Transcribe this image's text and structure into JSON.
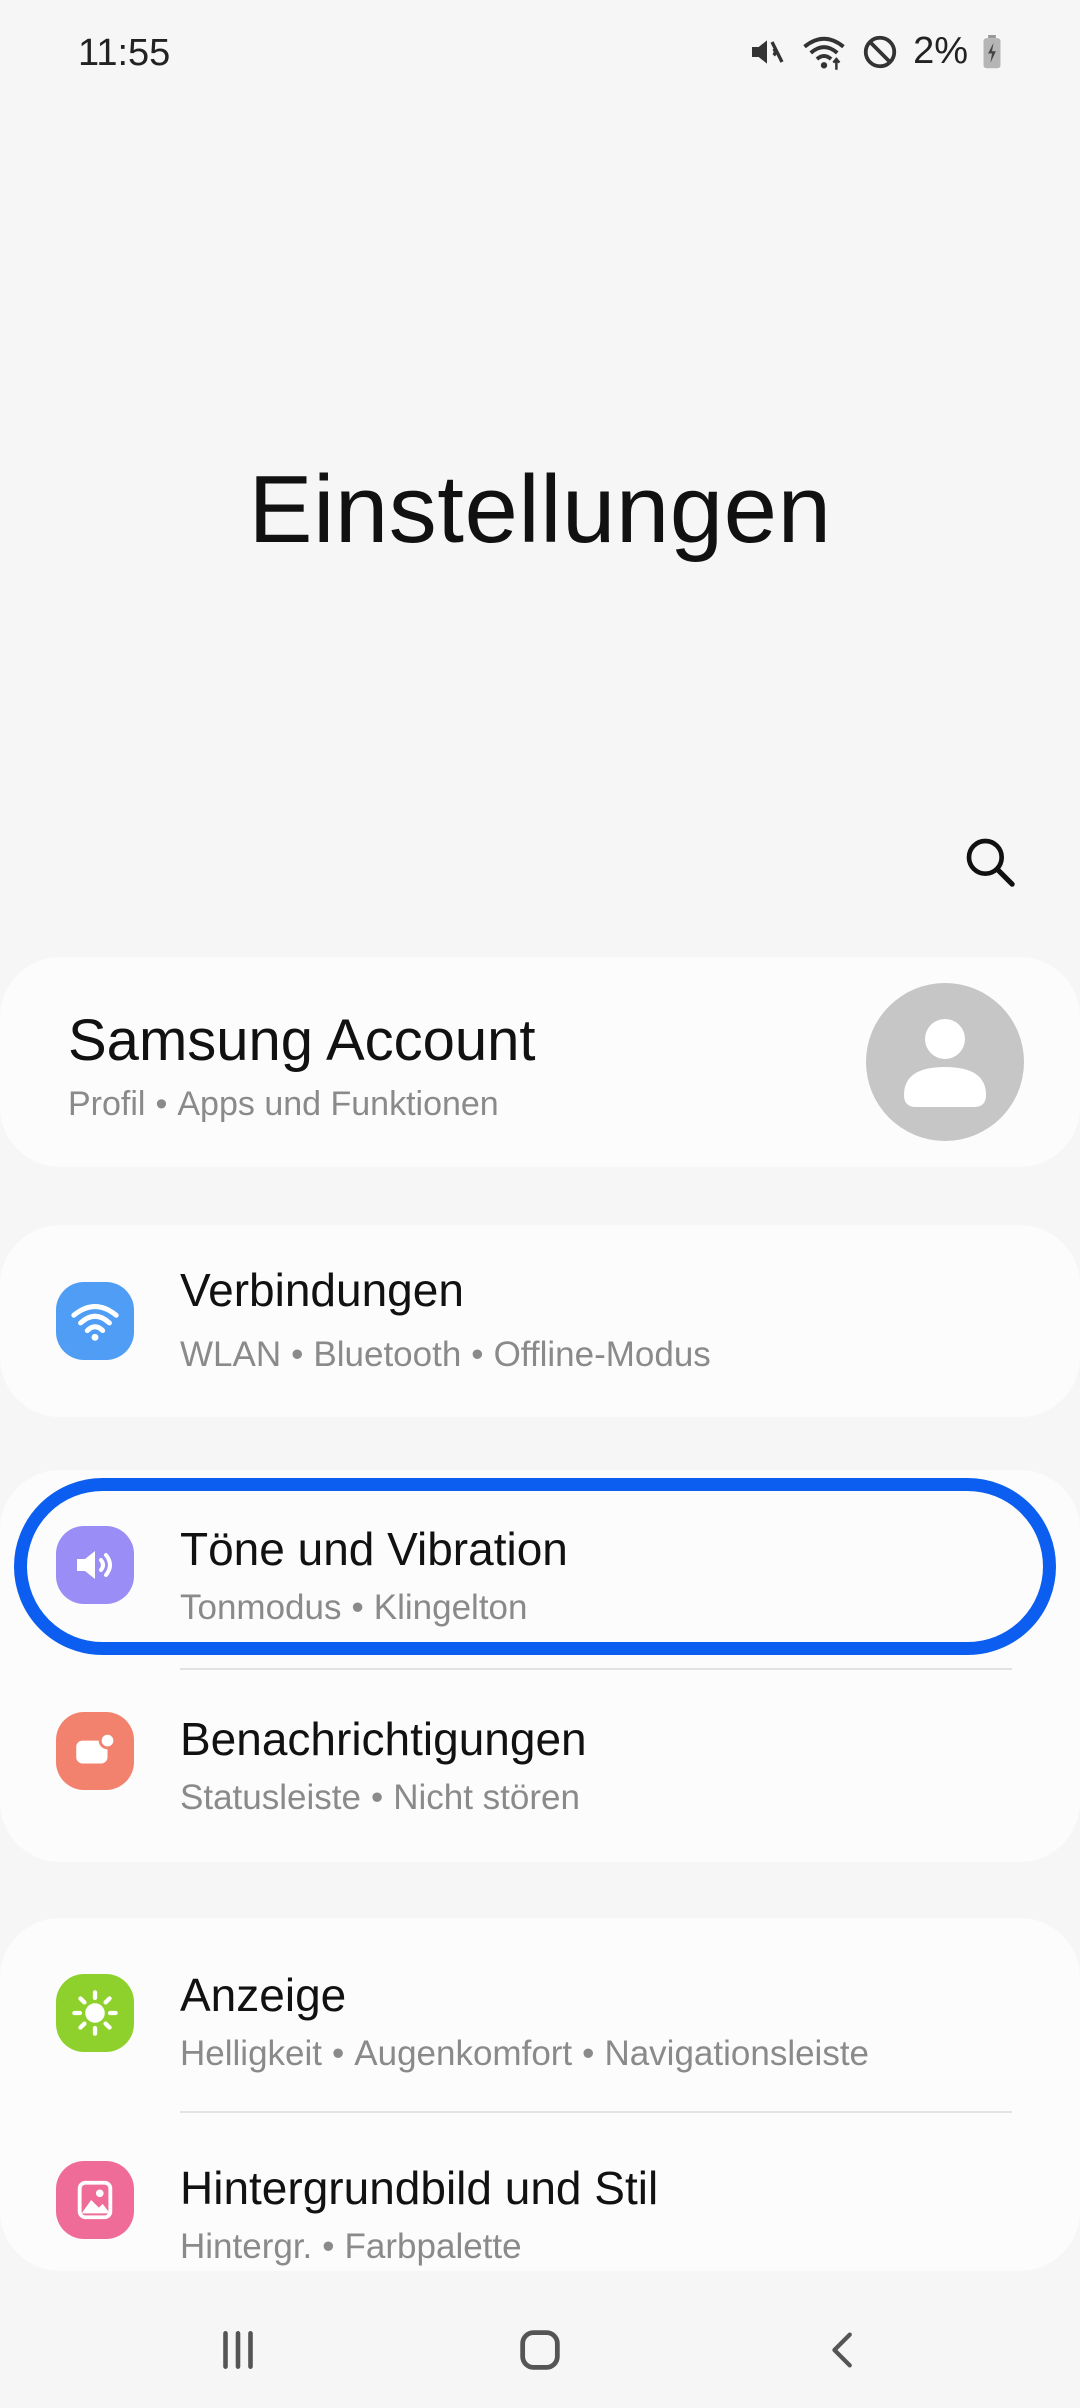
{
  "status_bar": {
    "time": "11:55",
    "battery_percent": "2%",
    "icons": [
      "mute-icon",
      "wifi-icon",
      "dnd-icon",
      "battery-charging-icon"
    ]
  },
  "page": {
    "title": "Einstellungen"
  },
  "search": {
    "icon": "search-icon"
  },
  "account": {
    "title": "Samsung Account",
    "sub": [
      "Profil",
      "Apps und Funktionen"
    ]
  },
  "items": [
    {
      "title": "Verbindungen",
      "sub": [
        "WLAN",
        "Bluetooth",
        "Offline-Modus"
      ],
      "icon": "wifi-icon",
      "color": "#4f9df4"
    },
    {
      "title": "Töne und Vibration",
      "sub": [
        "Tonmodus",
        "Klingelton"
      ],
      "icon": "speaker-icon",
      "color": "#9a8df5"
    },
    {
      "title": "Benachrichtigungen",
      "sub": [
        "Statusleiste",
        "Nicht stören"
      ],
      "icon": "notification-icon",
      "color": "#f2826d"
    },
    {
      "title": "Anzeige",
      "sub": [
        "Helligkeit",
        "Augenkomfort",
        "Navigationsleiste"
      ],
      "icon": "sun-icon",
      "color": "#8fd12c"
    },
    {
      "title": "Hintergrundbild und Stil",
      "sub": [
        "Hintergr.",
        "Farbpalette"
      ],
      "icon": "wallpaper-icon",
      "color": "#ef6c99"
    }
  ],
  "colors": {
    "highlight": "#0b5ef0",
    "background": "#f6f6f6",
    "card": "#fcfcfc",
    "subtext": "#8a8a8a"
  },
  "nav": {
    "recents_icon": "recents-icon",
    "home_icon": "home-icon",
    "back_icon": "back-icon"
  }
}
